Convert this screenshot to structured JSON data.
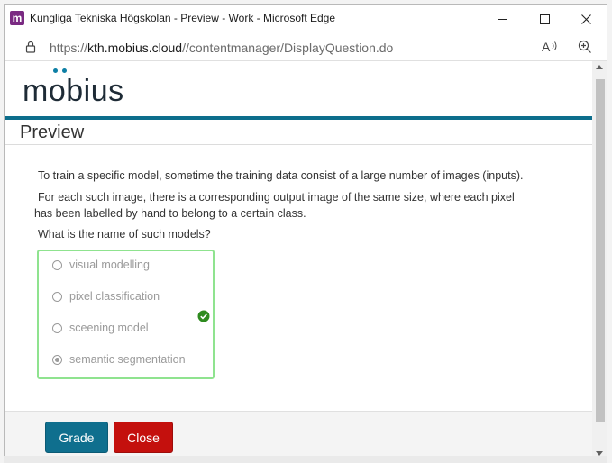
{
  "window": {
    "title": "Kungliga Tekniska Högskolan - Preview - Work - Microsoft Edge",
    "app_icon_letter": "m"
  },
  "address": {
    "protocol": "https://",
    "host": "kth.mobius.cloud",
    "path": "//contentmanager/DisplayQuestion.do"
  },
  "brand": {
    "logo_before": "m",
    "logo_o": "o",
    "logo_after": "bius",
    "accent_color": "#0d6e8c"
  },
  "page": {
    "title": "Preview"
  },
  "question": {
    "line1": "To train a specific model, sometime the training data consist of a large number of images (inputs).",
    "line2": "For each such image, there is a corresponding output image of the same size, where each pixel",
    "line3": "has been labelled by hand to belong to a certain class.",
    "line4": "What is the name of such models?"
  },
  "answers": {
    "options": [
      {
        "label": "visual modelling",
        "selected": false
      },
      {
        "label": "pixel classification",
        "selected": false
      },
      {
        "label": "sceening model",
        "selected": false
      },
      {
        "label": "semantic segmentation",
        "selected": true
      }
    ],
    "status": "correct",
    "status_icon": "check-circle-icon"
  },
  "footer": {
    "grade_label": "Grade",
    "close_label": "Close"
  }
}
